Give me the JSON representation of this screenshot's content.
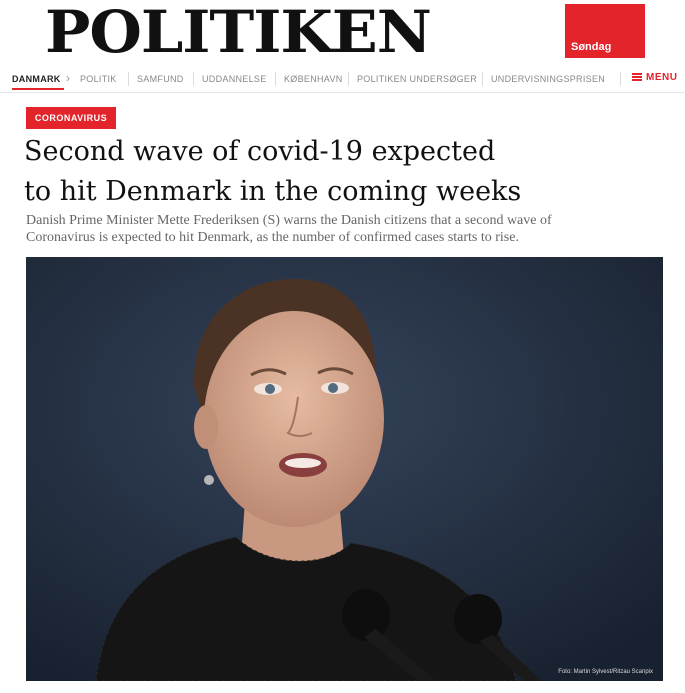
{
  "masthead": {
    "logo": "POLITIKEN",
    "edition": "Søndag"
  },
  "nav": {
    "items": [
      {
        "label": "DANMARK"
      },
      {
        "label": "POLITIK"
      },
      {
        "label": "SAMFUND"
      },
      {
        "label": "UDDANNELSE"
      },
      {
        "label": "KØBENHAVN"
      },
      {
        "label": "POLITIKEN UNDERSØGER"
      },
      {
        "label": "UNDERVISNINGSPRISEN"
      }
    ],
    "menu_label": "MENU"
  },
  "article": {
    "section_tag": "CORONAVIRUS",
    "headline_line1": "Second wave of covid-19 expected",
    "headline_line2": "to hit Denmark in the coming weeks",
    "lead_line1": "Danish Prime Minister Mette Frederiksen (S) warns the Danish citizens that a second wave of",
    "lead_line2": "Coronavirus is expected to hit Denmark, as the number of confirmed cases starts to rise.",
    "photo_credit": "Foto: Martin Sylvest/Ritzau Scanpix"
  },
  "colors": {
    "brand_red": "#e3242b",
    "photo_background": "#1f2a3c"
  },
  "icons": [
    "menu-icon",
    "chevron-right-icon",
    "microphone-icon"
  ]
}
